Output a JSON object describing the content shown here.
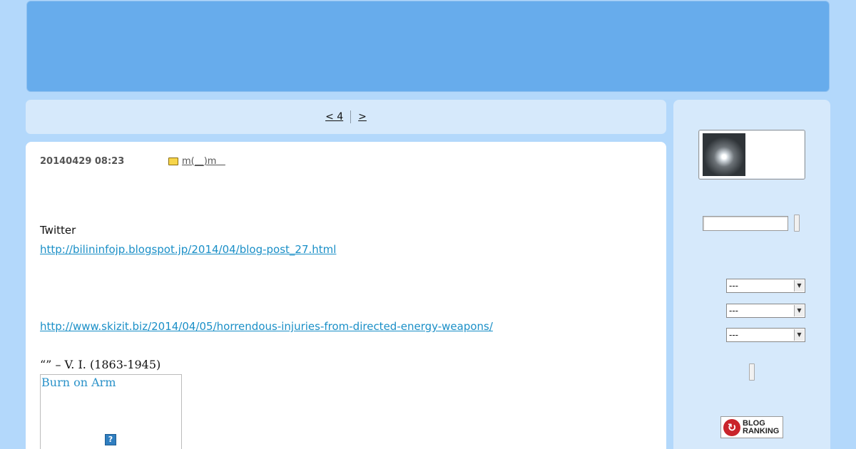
{
  "nav": {
    "prev_label": "< 4    ",
    "next_label": " >   "
  },
  "post": {
    "datetime": "20140429 08:23",
    "category": "m(__)m",
    "category_suffix": "   ",
    "twitter_label": "Twitter",
    "link1": "http://bilininfojp.blogspot.jp/2014/04/blog-post_27.html",
    "link2": "http://www.skizit.biz/2014/04/05/horrendous-injuries-from-directed-energy-weapons/",
    "quote": "“” – V. I.  (1863-1945)",
    "image_alt": "Burn on Arm",
    "image_missing_icon": "?"
  },
  "sidebar": {
    "select_value_1": "---",
    "select_value_2": "---",
    "select_value_3": "---",
    "ranking_line1": "BLOG",
    "ranking_line2": "RANKING"
  },
  "colors": {
    "page_bg": "#b3d8fb",
    "header_bg": "#67acec",
    "panel_bg": "#d6e9fb",
    "link": "#1a8fc7"
  }
}
